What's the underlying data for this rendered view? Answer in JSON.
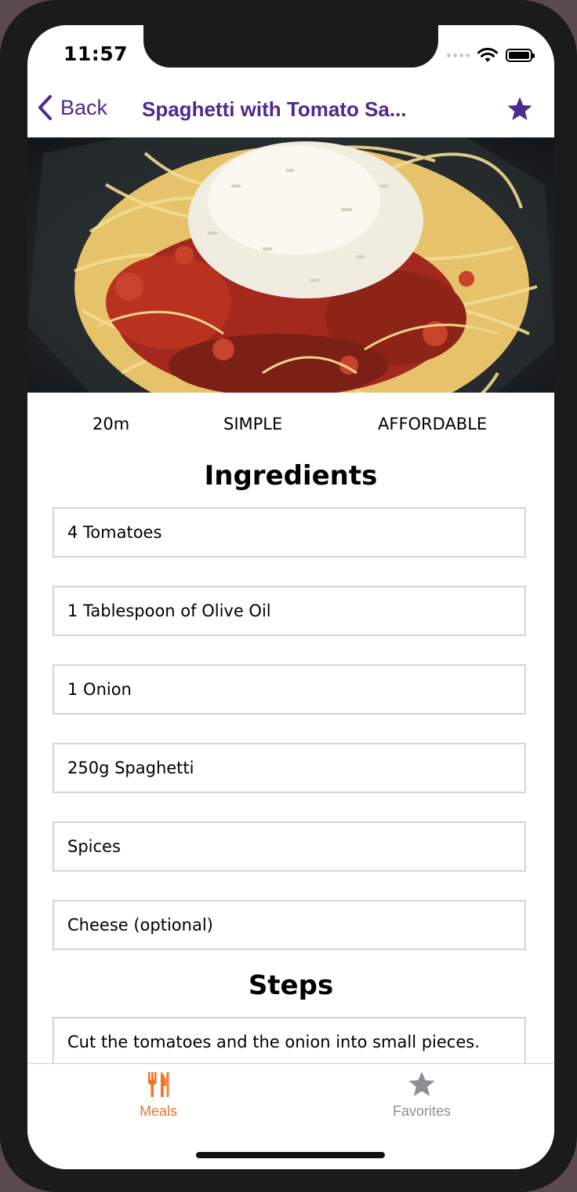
{
  "status_bar": {
    "time": "11:57"
  },
  "navbar": {
    "back_label": "Back",
    "title": "Spaghetti with Tomato Sa...",
    "accent_color": "#4e2a8e",
    "favorite_icon": "star-icon"
  },
  "meal": {
    "duration": "20m",
    "complexity": "SIMPLE",
    "affordability": "AFFORDABLE"
  },
  "ingredients": {
    "heading": "Ingredients",
    "items": [
      "4 Tomatoes",
      "1 Tablespoon of Olive Oil",
      "1 Onion",
      "250g Spaghetti",
      "Spices",
      "Cheese (optional)"
    ]
  },
  "steps": {
    "heading": "Steps",
    "items": [
      "Cut the tomatoes and the onion into small pieces."
    ]
  },
  "tabbar": {
    "tabs": [
      {
        "label": "Meals",
        "icon": "cutlery-icon",
        "active": true,
        "color": "#f37121"
      },
      {
        "label": "Favorites",
        "icon": "star-icon",
        "active": false,
        "color": "#8e8e93"
      }
    ]
  }
}
